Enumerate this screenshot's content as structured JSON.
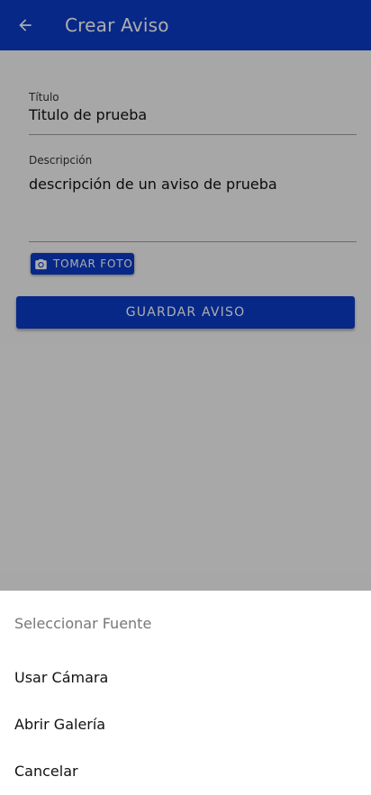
{
  "app_bar": {
    "title": "Crear Aviso",
    "back_icon": "arrow-back-icon",
    "color": "#0b3cc7"
  },
  "form": {
    "title_label": "Título",
    "title_value": "Titulo de prueba",
    "description_label": "Descripción",
    "description_value": "descripción de un aviso de prueba",
    "photo_button_label": "TOMAR FOTO",
    "photo_icon": "camera-icon",
    "save_button_label": "GUARDAR AVISO"
  },
  "bottom_sheet": {
    "title": "Seleccionar Fuente",
    "options": [
      "Usar Cámara",
      "Abrir Galería",
      "Cancelar"
    ]
  }
}
